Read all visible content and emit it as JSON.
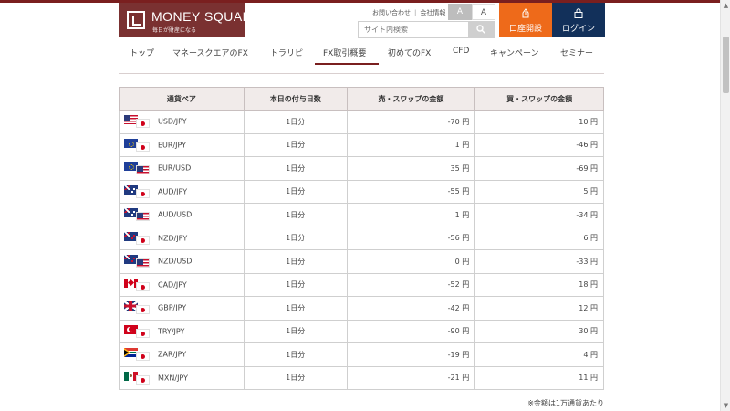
{
  "header": {
    "logo_title": "MONEY SQUARE",
    "logo_subtitle": "毎日が財産になる",
    "util_links": [
      "お問い合わせ",
      "会社情報"
    ],
    "font_small_label": "A",
    "font_large_label": "A",
    "search_placeholder": "サイト内検索",
    "open_account_label": "口座開設",
    "login_label": "ログイン"
  },
  "nav": {
    "items": [
      "トップ",
      "マネースクエアのFX",
      "トラリピ",
      "FX取引概要",
      "初めてのFX",
      "CFD",
      "キャンペーン",
      "セミナー"
    ],
    "active": "FX取引概要"
  },
  "table": {
    "headers": [
      "通貨ペア",
      "本日の付与日数",
      "売・スワップの金額",
      "買・スワップの金額"
    ],
    "rows": [
      {
        "pair": "USD/JPY",
        "base_flag": "us-flag-icon",
        "quote_flag": "jp-flag-icon",
        "days": "1日分",
        "sell": "-70 円",
        "buy": "10 円"
      },
      {
        "pair": "EUR/JPY",
        "base_flag": "eu-flag-icon",
        "quote_flag": "jp-flag-icon",
        "days": "1日分",
        "sell": "1 円",
        "buy": "-46 円"
      },
      {
        "pair": "EUR/USD",
        "base_flag": "eu-flag-icon",
        "quote_flag": "us-flag-icon",
        "days": "1日分",
        "sell": "35 円",
        "buy": "-69 円"
      },
      {
        "pair": "AUD/JPY",
        "base_flag": "au-flag-icon",
        "quote_flag": "jp-flag-icon",
        "days": "1日分",
        "sell": "-55 円",
        "buy": "5 円"
      },
      {
        "pair": "AUD/USD",
        "base_flag": "au-flag-icon",
        "quote_flag": "us-flag-icon",
        "days": "1日分",
        "sell": "1 円",
        "buy": "-34 円"
      },
      {
        "pair": "NZD/JPY",
        "base_flag": "nz-flag-icon",
        "quote_flag": "jp-flag-icon",
        "days": "1日分",
        "sell": "-56 円",
        "buy": "6 円"
      },
      {
        "pair": "NZD/USD",
        "base_flag": "nz-flag-icon",
        "quote_flag": "us-flag-icon",
        "days": "1日分",
        "sell": "0 円",
        "buy": "-33 円"
      },
      {
        "pair": "CAD/JPY",
        "base_flag": "ca-flag-icon",
        "quote_flag": "jp-flag-icon",
        "days": "1日分",
        "sell": "-52 円",
        "buy": "18 円"
      },
      {
        "pair": "GBP/JPY",
        "base_flag": "gb-flag-icon",
        "quote_flag": "jp-flag-icon",
        "days": "1日分",
        "sell": "-42 円",
        "buy": "12 円"
      },
      {
        "pair": "TRY/JPY",
        "base_flag": "tr-flag-icon",
        "quote_flag": "jp-flag-icon",
        "days": "1日分",
        "sell": "-90 円",
        "buy": "30 円"
      },
      {
        "pair": "ZAR/JPY",
        "base_flag": "za-flag-icon",
        "quote_flag": "jp-flag-icon",
        "days": "1日分",
        "sell": "-19 円",
        "buy": "4 円"
      },
      {
        "pair": "MXN/JPY",
        "base_flag": "mx-flag-icon",
        "quote_flag": "jp-flag-icon",
        "days": "1日分",
        "sell": "-21 円",
        "buy": "11 円"
      }
    ]
  },
  "footnote": "※金額は1万通貨あたり",
  "colors": {
    "brand": "#7a3131",
    "open_account": "#ee6a1a",
    "login": "#12305a",
    "header_cell": "#f1ebea"
  }
}
